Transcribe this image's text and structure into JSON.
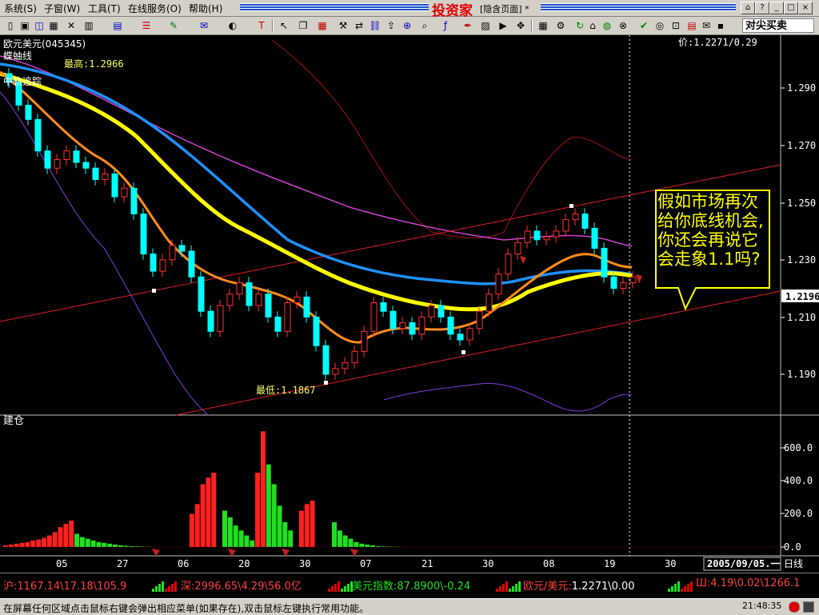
{
  "menu": {
    "items": [
      "系统(S)",
      "子窗(W)",
      "工具(T)",
      "在线服务(O)",
      "帮助(H)"
    ]
  },
  "window": {
    "brand": "投资家",
    "page_title": "[隐含页面]",
    "modified_mark": "*"
  },
  "toolbar": {
    "combo_value": "对尖买卖"
  },
  "chart": {
    "symbol": "欧元美元(045345)",
    "indicator_name": "蝶蚰线",
    "overlay_label": "中轨追踪",
    "price_readout": "价:1.2271/0.29",
    "high_label": "最高:1.2966",
    "low_label": "最低:1.1867",
    "current_price_tag": "1.2196",
    "annotation": "假如市场再次给你底线机会,你还会再说它会走象1.1吗?",
    "sub_panel_label": "建仓",
    "date_label": "2005/09/05.一",
    "period_label": "日线",
    "colors": {
      "up": "#ff3030",
      "down": "#00ffff",
      "ma_yellow": "#ffff00",
      "ma_blue": "#1e90ff",
      "ma_orange": "#ff8c1a",
      "accent": "#e00000"
    }
  },
  "chart_data": [
    {
      "type": "candlestick",
      "title": "欧元美元(045345)",
      "ylim": [
        1.178,
        1.302
      ],
      "y_ticks": [
        "1.290",
        "1.270",
        "1.250",
        "1.230",
        "1.210",
        "1.190"
      ],
      "x_ticks": [
        "05",
        "27",
        "06",
        "20",
        "30",
        "07",
        "21",
        "30",
        "08",
        "19",
        "30"
      ],
      "series": [
        {
          "name": "high",
          "marker": "1.2966"
        },
        {
          "name": "low",
          "marker": "1.1867"
        },
        {
          "name": "last",
          "value": 1.2196
        }
      ]
    },
    {
      "type": "bar",
      "title": "建仓",
      "ylim": [
        0,
        700
      ],
      "y_ticks": [
        "600.0",
        "400.0",
        "200.0",
        "0.0"
      ],
      "series": [
        {
          "name": "red",
          "color": "#ff2020",
          "values": [
            10,
            15,
            20,
            25,
            30,
            40,
            45,
            55,
            70,
            90,
            120,
            140,
            160,
            0,
            0,
            0,
            0,
            0,
            0,
            0,
            0,
            0,
            0,
            0,
            0,
            0,
            0,
            0,
            0,
            0,
            0,
            0,
            0,
            0,
            200,
            260,
            380,
            420,
            450,
            0,
            0,
            0,
            0,
            0,
            0,
            0,
            450,
            700,
            0,
            0,
            0,
            0,
            0,
            0,
            220,
            260,
            280,
            0,
            0,
            0,
            0,
            0,
            0,
            0,
            0,
            0,
            0,
            0,
            0,
            0,
            0,
            0,
            0,
            0,
            0,
            0,
            0,
            0,
            0,
            0,
            0,
            0,
            0,
            0,
            0,
            0,
            0,
            0,
            0,
            0,
            0,
            0,
            0,
            0,
            0,
            0,
            0,
            0,
            0
          ]
        },
        {
          "name": "green",
          "color": "#20e020",
          "values": [
            0,
            0,
            0,
            0,
            0,
            0,
            0,
            0,
            0,
            0,
            0,
            0,
            0,
            80,
            60,
            50,
            40,
            30,
            25,
            20,
            15,
            10,
            8,
            5,
            4,
            3,
            2,
            0,
            0,
            0,
            0,
            0,
            0,
            0,
            0,
            0,
            0,
            0,
            0,
            0,
            220,
            180,
            130,
            100,
            70,
            40,
            0,
            0,
            500,
            380,
            250,
            150,
            100,
            0,
            0,
            0,
            0,
            0,
            0,
            0,
            150,
            100,
            70,
            50,
            30,
            20,
            15,
            10,
            5,
            4,
            3,
            2,
            1,
            0,
            0,
            0,
            0,
            0,
            0,
            0,
            0,
            0,
            0,
            0,
            0,
            0,
            0,
            0,
            0,
            0,
            0,
            0,
            0,
            0,
            0,
            0,
            0,
            0
          ]
        }
      ]
    }
  ],
  "ticker": [
    {
      "label": "沪:",
      "value": "1167.14\\17.18\\105.9"
    },
    {
      "label": "深:",
      "value": "2996.65\\4.29\\56.0亿"
    },
    {
      "label": "美元指数:",
      "value": "87.8900\\-0.24"
    },
    {
      "label": "欧元/美元:",
      "value": "1.2271\\0.00"
    },
    {
      "label": "Ш:",
      "value": "4.19\\0.02\\1266.1"
    }
  ],
  "status": {
    "message": "在屏幕任何区域点击鼠标右键会弹出相应菜单(如果存在),双击鼠标左键执行常用功能。",
    "time": "21:48:35"
  }
}
